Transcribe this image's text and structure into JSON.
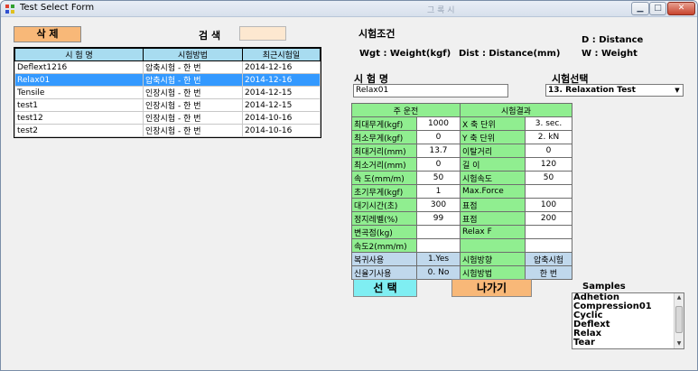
{
  "window": {
    "title": "Test Select Form",
    "ghost_text": "그 록 시"
  },
  "toolbar": {
    "delete_label": "삭 제",
    "search_label": "검 색"
  },
  "grid": {
    "headers": [
      "시 험 명",
      "시험방법",
      "최근시험일"
    ],
    "rows": [
      [
        "Deflext1216",
        "압축시험 - 한 번",
        "2014-12-16"
      ],
      [
        "Relax01",
        "압축시험 - 한 번",
        "2014-12-16"
      ],
      [
        "Tensile",
        "인장시험 - 한 번",
        "2014-12-15"
      ],
      [
        "test1",
        "인장시험 - 한 번",
        "2014-12-15"
      ],
      [
        "test12",
        "인장시험 - 한 번",
        "2014-10-16"
      ],
      [
        "test2",
        "인장시험 - 한 번",
        "2014-10-16"
      ]
    ],
    "selected_row": 1
  },
  "conditions": {
    "title": "시험조건",
    "wgt": "Wgt : Weight(kgf)",
    "dist": "Dist : Distance(mm)",
    "d": "D : Distance",
    "w": "W : Weight"
  },
  "test": {
    "name_label": "시 험 명",
    "name_value": "Relax01",
    "select_label": "시험선택",
    "select_value": "13. Relaxation Test"
  },
  "params": {
    "header_left": "주 운전",
    "header_right": "시험결과",
    "rows": [
      [
        "최대무게(kgf)",
        "1000",
        "X 축 단위",
        "3. sec."
      ],
      [
        "최소무게(kgf)",
        "0",
        "Y 축 단위",
        "2. kN"
      ],
      [
        "최대거리(mm)",
        "13.7",
        "이탈거리",
        "0"
      ],
      [
        "최소거리(mm)",
        "0",
        "길 이",
        "120"
      ],
      [
        "속 도(mm/m)",
        "50",
        "시험속도",
        "50"
      ],
      [
        "초기무게(kgf)",
        "1",
        "Max.Force",
        ""
      ],
      [
        "대기시간(초)",
        "300",
        "표점",
        "100"
      ],
      [
        "정지레벨(%)",
        "99",
        "표점",
        "200"
      ],
      [
        "변곡점(kg)",
        "",
        "Relax F",
        ""
      ],
      [
        "속도2(mm/m)",
        "",
        "",
        ""
      ],
      [
        "복귀사용",
        "1.Yes",
        "시험방향",
        "압축시험"
      ],
      [
        "신율기사용",
        "0. No",
        "시험방법",
        "한 번"
      ]
    ]
  },
  "buttons": {
    "select": "선 택",
    "exit": "나가기"
  },
  "samples": {
    "label": "Samples",
    "items": [
      "Adhetion",
      "Compression01",
      "Cyclic",
      "Deflext",
      "Relax",
      "Tear"
    ]
  }
}
